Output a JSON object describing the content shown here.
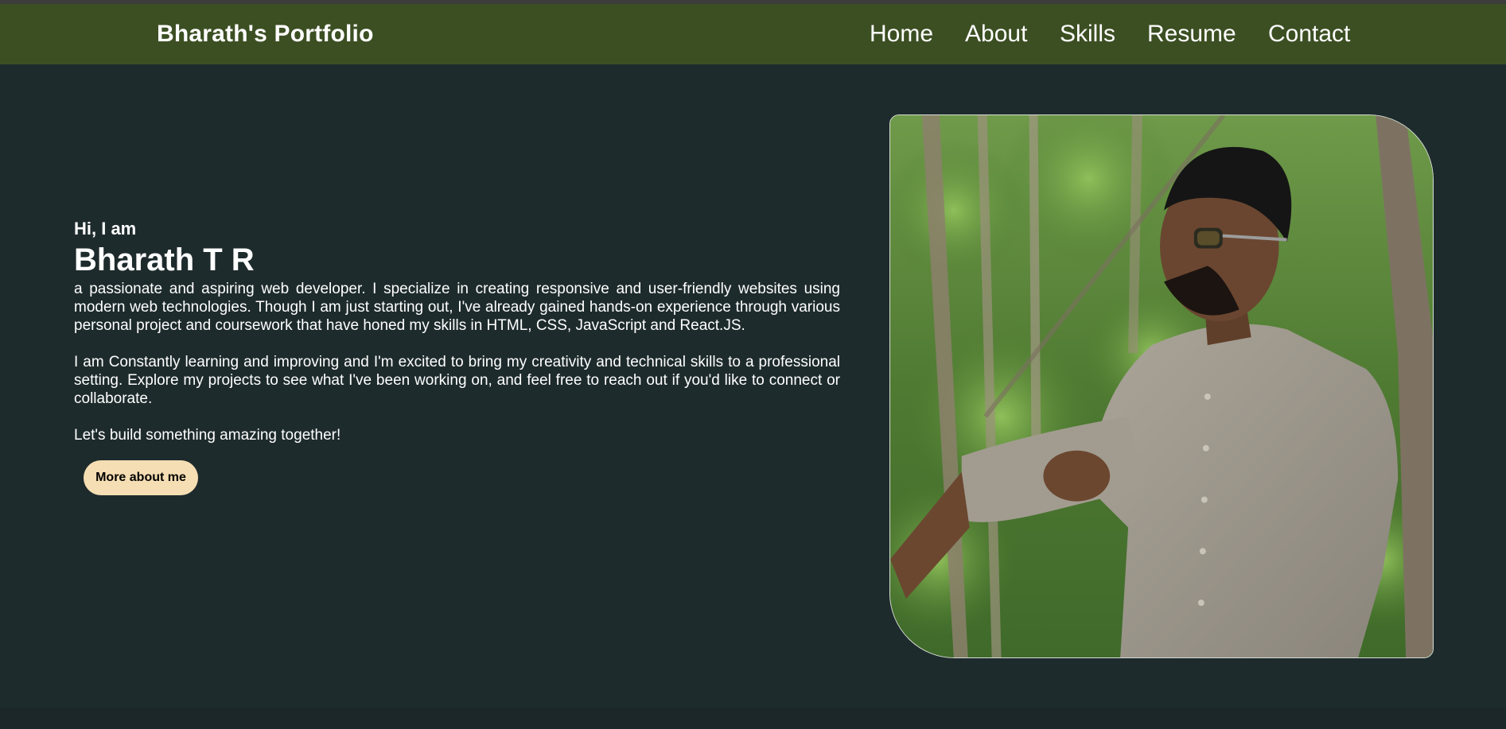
{
  "nav": {
    "brand": "Bharath's Portfolio",
    "links": [
      "Home",
      "About",
      "Skills",
      "Resume",
      "Contact"
    ]
  },
  "hero": {
    "greeting": "Hi, I am",
    "name": "Bharath T R",
    "bio_paragraph_1": "a passionate and aspiring web developer. I specialize in creating responsive and user-friendly websites using modern web technologies. Though I am just starting out, I've already gained hands-on experience through various personal project and coursework that have honed my skills in HTML, CSS, JavaScript and React.JS.",
    "bio_paragraph_2": "I am Constantly learning and improving and I'm excited to bring my creativity and technical skills to a professional setting. Explore my projects to see what I've been working on, and feel free to reach out if you'd like to connect or collaborate.",
    "closing": "Let's build something amazing together!",
    "button_label": "More about me"
  },
  "colors": {
    "page_background": "#1e2b2d",
    "navbar_background": "#3c4f23",
    "button_background": "#f5deb3",
    "text": "#ffffff"
  }
}
